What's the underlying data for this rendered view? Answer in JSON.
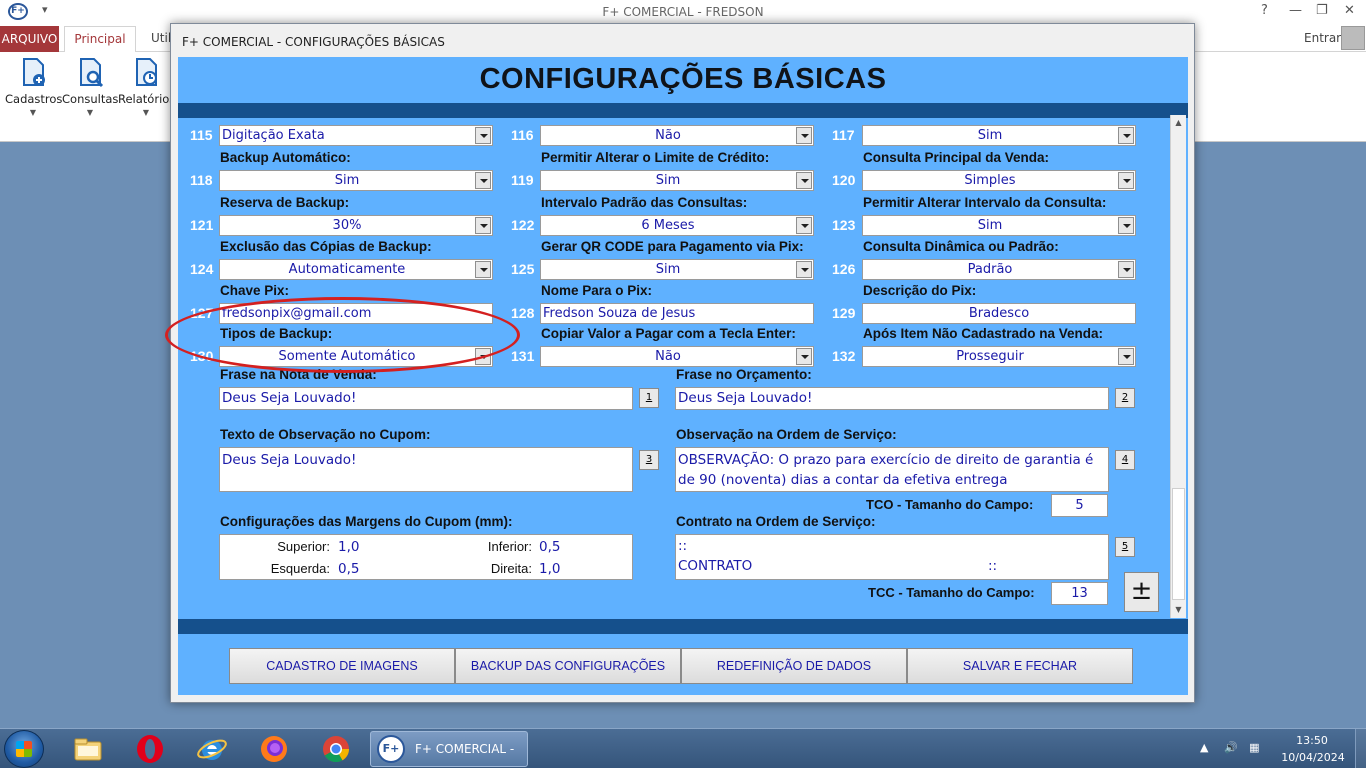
{
  "app": {
    "title": "F+ COMERCIAL - FREDSON",
    "logo": "F+",
    "help": "?",
    "minimize": "—",
    "restore": "❐",
    "close": "✕"
  },
  "ribbon": {
    "tabs": {
      "arquivo": "ARQUIVO",
      "principal": "Principal",
      "util": "Util"
    },
    "signin": "Entrar",
    "buttons": [
      {
        "label": "Cadastros",
        "icon": "cadastros-icon"
      },
      {
        "label": "Consultas",
        "icon": "consultas-icon"
      },
      {
        "label": "Relatórios",
        "icon": "relatorios-icon"
      }
    ]
  },
  "dialog": {
    "window_title": "F+ COMERCIAL - CONFIGURAÇÕES BÁSICAS",
    "heading": "CONFIGURAÇÕES BÁSICAS",
    "fields": [
      {
        "num": "115",
        "label": "",
        "value": "Digitação Exata",
        "type": "combo",
        "align": "left"
      },
      {
        "num": "116",
        "label": "",
        "value": "Não",
        "type": "combo"
      },
      {
        "num": "117",
        "label": "",
        "value": "Sim",
        "type": "combo"
      },
      {
        "num": "118",
        "label": "Backup Automático:",
        "value": "Sim",
        "type": "combo"
      },
      {
        "num": "119",
        "label": "Permitir Alterar o Limite de Crédito:",
        "value": "Sim",
        "type": "combo"
      },
      {
        "num": "120",
        "label": "Consulta Principal da Venda:",
        "value": "Simples",
        "type": "combo"
      },
      {
        "num": "121",
        "label": "Reserva de Backup:",
        "value": "30%",
        "type": "combo"
      },
      {
        "num": "122",
        "label": "Intervalo Padrão das Consultas:",
        "value": "6 Meses",
        "type": "combo"
      },
      {
        "num": "123",
        "label": "Permitir Alterar Intervalo da Consulta:",
        "value": "Sim",
        "type": "combo"
      },
      {
        "num": "124",
        "label": "Exclusão das Cópias de Backup:",
        "value": "Automaticamente",
        "type": "combo"
      },
      {
        "num": "125",
        "label": "Gerar QR CODE para Pagamento via Pix:",
        "value": "Sim",
        "type": "combo"
      },
      {
        "num": "126",
        "label": "Consulta Dinâmica ou Padrão:",
        "value": "Padrão",
        "type": "combo"
      },
      {
        "num": "127",
        "label": "Chave Pix:",
        "value": "fredsonpix@gmail.com",
        "type": "text",
        "align": "left"
      },
      {
        "num": "128",
        "label": "Nome Para o Pix:",
        "value": "Fredson Souza de Jesus",
        "type": "text",
        "align": "left"
      },
      {
        "num": "129",
        "label": "Descrição do Pix:",
        "value": "Bradesco",
        "type": "text"
      },
      {
        "num": "130",
        "label": "Tipos de Backup:",
        "value": "Somente Automático",
        "type": "combo"
      },
      {
        "num": "131",
        "label": "Copiar Valor a Pagar com a Tecla Enter:",
        "value": "Não",
        "type": "combo"
      },
      {
        "num": "132",
        "label": "Após Item Não Cadastrado na Venda:",
        "value": "Prosseguir",
        "type": "combo"
      }
    ],
    "frase_nota": {
      "label": "Frase na Nota de Venda:",
      "value": "Deus Seja Louvado!",
      "btn": "1"
    },
    "frase_orcamento": {
      "label": "Frase no Orçamento:",
      "value": "Deus Seja Louvado!",
      "btn": "2"
    },
    "obs_cupom": {
      "label": "Texto de Observação no Cupom:",
      "value": "Deus Seja Louvado!",
      "btn": "3"
    },
    "obs_os": {
      "label": "Observação na Ordem de Serviço:",
      "value": "OBSERVAÇÃO: O prazo para exercício de direito de garantia é de 90 (noventa) dias a contar da efetiva entrega",
      "btn": "4"
    },
    "tco": {
      "label": "TCO - Tamanho do Campo:",
      "value": "5"
    },
    "margens": {
      "label": "Configurações das Margens do Cupom (mm):",
      "superior_label": "Superior:",
      "superior": "1,0",
      "inferior_label": "Inferior:",
      "inferior": "0,5",
      "esquerda_label": "Esquerda:",
      "esquerda": "0,5",
      "direita_label": "Direita:",
      "direita": "1,0"
    },
    "contrato": {
      "label": "Contrato na Ordem de Serviço:",
      "line1": "::",
      "line2": "CONTRATO",
      "line2_suffix": "::",
      "btn": "5"
    },
    "tcc": {
      "label": "TCC - Tamanho do Campo:",
      "value": "13"
    },
    "plus": "±",
    "buttons": {
      "cadastro_imagens": "CADASTRO DE IMAGENS",
      "backup_config": "BACKUP DAS CONFIGURAÇÕES",
      "redefinicao": "REDEFINIÇÃO DE DADOS",
      "salvar": "SALVAR E FECHAR"
    }
  },
  "taskbar": {
    "app_label": "F+ COMERCIAL - ...",
    "time": "13:50",
    "date": "10/04/2024",
    "pinned": [
      "explorer-icon",
      "opera-icon",
      "internet-explorer-icon",
      "firefox-icon",
      "chrome-icon"
    ]
  },
  "annotation_color": "#d42020"
}
